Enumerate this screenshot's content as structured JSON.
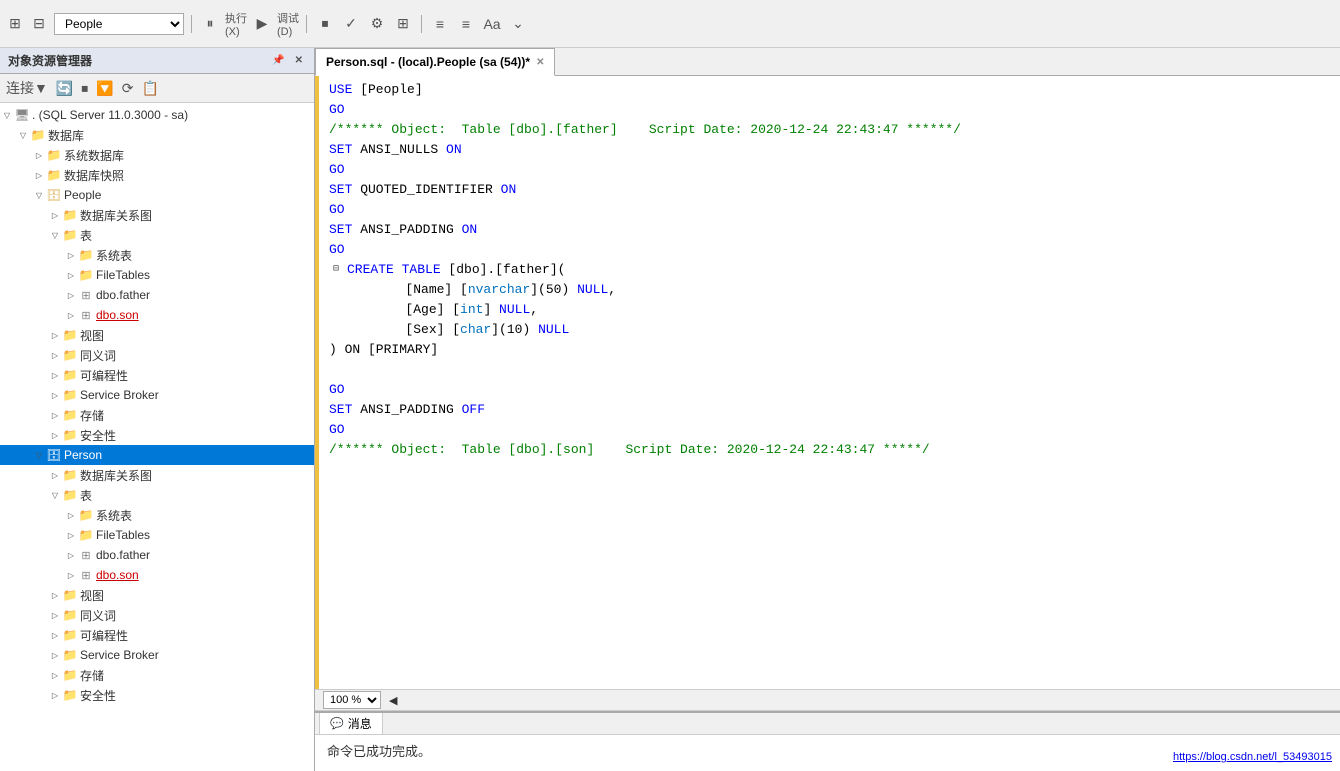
{
  "toolbar": {
    "db_label": "People",
    "menu_items": [
      "执行(X)",
      "▶",
      "调试(D)"
    ]
  },
  "panel": {
    "title": "对象资源管理器",
    "connect_label": "连接▼"
  },
  "tree": {
    "root": ". (SQL Server 11.0.3000 - sa)",
    "items": [
      {
        "id": "databases",
        "label": "数据库",
        "level": 1,
        "expanded": true,
        "icon": "folder"
      },
      {
        "id": "sys-dbs",
        "label": "系统数据库",
        "level": 2,
        "expanded": false,
        "icon": "folder"
      },
      {
        "id": "snapshots",
        "label": "数据库快照",
        "level": 2,
        "expanded": false,
        "icon": "folder"
      },
      {
        "id": "people-db",
        "label": "People",
        "level": 2,
        "expanded": true,
        "icon": "db"
      },
      {
        "id": "people-diagrams",
        "label": "数据库关系图",
        "level": 3,
        "expanded": false,
        "icon": "folder"
      },
      {
        "id": "people-tables",
        "label": "表",
        "level": 3,
        "expanded": true,
        "icon": "folder"
      },
      {
        "id": "people-sys-tables",
        "label": "系统表",
        "level": 4,
        "expanded": false,
        "icon": "folder"
      },
      {
        "id": "people-filetables",
        "label": "FileTables",
        "level": 4,
        "expanded": false,
        "icon": "folder"
      },
      {
        "id": "people-father",
        "label": "dbo.father",
        "level": 4,
        "expanded": false,
        "icon": "table"
      },
      {
        "id": "people-son",
        "label": "dbo.son",
        "level": 4,
        "expanded": false,
        "icon": "table",
        "underline": true
      },
      {
        "id": "people-views",
        "label": "视图",
        "level": 3,
        "expanded": false,
        "icon": "folder"
      },
      {
        "id": "people-synonyms",
        "label": "同义词",
        "level": 3,
        "expanded": false,
        "icon": "folder"
      },
      {
        "id": "people-prog",
        "label": "可编程性",
        "level": 3,
        "expanded": false,
        "icon": "folder"
      },
      {
        "id": "people-broker",
        "label": "Service Broker",
        "level": 3,
        "expanded": false,
        "icon": "folder"
      },
      {
        "id": "people-storage",
        "label": "存储",
        "level": 3,
        "expanded": false,
        "icon": "folder"
      },
      {
        "id": "people-security",
        "label": "安全性",
        "level": 3,
        "expanded": false,
        "icon": "folder"
      },
      {
        "id": "person-db",
        "label": "Person",
        "level": 2,
        "expanded": true,
        "icon": "db",
        "selected": true
      },
      {
        "id": "person-diagrams",
        "label": "数据库关系图",
        "level": 3,
        "expanded": false,
        "icon": "folder"
      },
      {
        "id": "person-tables",
        "label": "表",
        "level": 3,
        "expanded": true,
        "icon": "folder"
      },
      {
        "id": "person-sys-tables",
        "label": "系统表",
        "level": 4,
        "expanded": false,
        "icon": "folder"
      },
      {
        "id": "person-filetables",
        "label": "FileTables",
        "level": 4,
        "expanded": false,
        "icon": "folder"
      },
      {
        "id": "person-father",
        "label": "dbo.father",
        "level": 4,
        "expanded": false,
        "icon": "table"
      },
      {
        "id": "person-son",
        "label": "dbo.son",
        "level": 4,
        "expanded": false,
        "icon": "table",
        "underline": true
      },
      {
        "id": "person-views",
        "label": "视图",
        "level": 3,
        "expanded": false,
        "icon": "folder"
      },
      {
        "id": "person-synonyms",
        "label": "同义词",
        "level": 3,
        "expanded": false,
        "icon": "folder"
      },
      {
        "id": "person-prog",
        "label": "可编程性",
        "level": 3,
        "expanded": false,
        "icon": "folder"
      },
      {
        "id": "person-broker",
        "label": "Service Broker",
        "level": 3,
        "expanded": false,
        "icon": "folder"
      },
      {
        "id": "person-storage",
        "label": "存储",
        "level": 3,
        "expanded": false,
        "icon": "folder"
      },
      {
        "id": "person-security2",
        "label": "安全性",
        "level": 3,
        "expanded": false,
        "icon": "folder"
      }
    ]
  },
  "tab": {
    "title": "Person.sql - (local).People (sa (54))*",
    "modified": true
  },
  "sql_lines": [
    {
      "type": "code",
      "marker": "bar",
      "content": [
        {
          "cls": "kw",
          "t": "USE"
        },
        {
          "cls": "plain",
          "t": " [People]"
        }
      ]
    },
    {
      "type": "code",
      "content": [
        {
          "cls": "kw",
          "t": "GO"
        }
      ]
    },
    {
      "type": "code",
      "content": [
        {
          "cls": "cm",
          "t": "/****** Object:  Table [dbo].[father]    Script Date: 2020-12-24 22:43:47 ******/"
        }
      ]
    },
    {
      "type": "code",
      "content": [
        {
          "cls": "kw",
          "t": "SET"
        },
        {
          "cls": "plain",
          "t": " ANSI_NULLS "
        },
        {
          "cls": "kw",
          "t": "ON"
        }
      ]
    },
    {
      "type": "code",
      "content": [
        {
          "cls": "kw",
          "t": "GO"
        }
      ]
    },
    {
      "type": "code",
      "content": [
        {
          "cls": "kw",
          "t": "SET"
        },
        {
          "cls": "plain",
          "t": " QUOTED_IDENTIFIER "
        },
        {
          "cls": "kw",
          "t": "ON"
        }
      ]
    },
    {
      "type": "code",
      "content": [
        {
          "cls": "kw",
          "t": "GO"
        }
      ]
    },
    {
      "type": "code",
      "content": [
        {
          "cls": "kw",
          "t": "SET"
        },
        {
          "cls": "plain",
          "t": " ANSI_PADDING "
        },
        {
          "cls": "kw",
          "t": "ON"
        }
      ]
    },
    {
      "type": "code",
      "content": [
        {
          "cls": "kw",
          "t": "GO"
        }
      ]
    },
    {
      "type": "code",
      "collapsible": true,
      "content": [
        {
          "cls": "kw",
          "t": "CREATE TABLE"
        },
        {
          "cls": "plain",
          "t": " [dbo].[father]("
        }
      ]
    },
    {
      "type": "code",
      "indent": "        ",
      "content": [
        {
          "cls": "plain",
          "t": "[Name] ["
        },
        {
          "cls": "kw2",
          "t": "nvarchar"
        },
        {
          "cls": "plain",
          "t": "](50) "
        },
        {
          "cls": "kw",
          "t": "NULL"
        },
        {
          "cls": "plain",
          "t": ","
        }
      ]
    },
    {
      "type": "code",
      "indent": "        ",
      "content": [
        {
          "cls": "plain",
          "t": "[Age] ["
        },
        {
          "cls": "kw2",
          "t": "int"
        },
        {
          "cls": "plain",
          "t": "] "
        },
        {
          "cls": "kw",
          "t": "NULL"
        },
        {
          "cls": "plain",
          "t": ","
        }
      ]
    },
    {
      "type": "code",
      "indent": "        ",
      "content": [
        {
          "cls": "plain",
          "t": "[Sex] ["
        },
        {
          "cls": "kw2",
          "t": "char"
        },
        {
          "cls": "plain",
          "t": "](10) "
        },
        {
          "cls": "kw",
          "t": "NULL"
        }
      ]
    },
    {
      "type": "code",
      "content": [
        {
          "cls": "plain",
          "t": ") ON [PRIMARY]"
        }
      ]
    },
    {
      "type": "empty"
    },
    {
      "type": "code",
      "content": [
        {
          "cls": "kw",
          "t": "GO"
        }
      ]
    },
    {
      "type": "code",
      "content": [
        {
          "cls": "kw",
          "t": "SET"
        },
        {
          "cls": "plain",
          "t": " ANSI_PADDING "
        },
        {
          "cls": "kw",
          "t": "OFF"
        }
      ]
    },
    {
      "type": "code",
      "content": [
        {
          "cls": "kw",
          "t": "GO"
        }
      ]
    },
    {
      "type": "code",
      "content": [
        {
          "cls": "cm",
          "t": "/****** Object:  Table [dbo].[son]    Script Date: 2020-12-24 22:43:47 *****/"
        }
      ]
    }
  ],
  "zoom": {
    "level": "100 %",
    "arrow": "◀"
  },
  "results": {
    "tab_label": "消息",
    "message": "命令已成功完成。"
  },
  "watermark": "https://blog.csdn.net/l_53493015"
}
